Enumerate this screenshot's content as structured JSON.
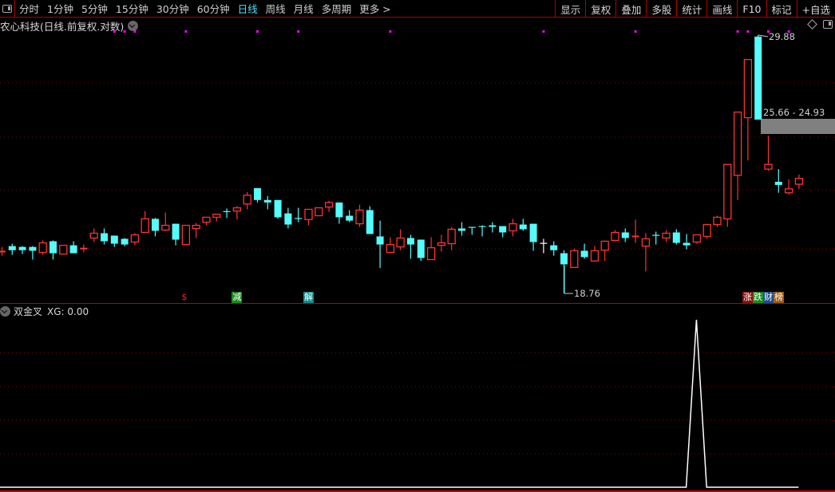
{
  "toolbar": {
    "periods": [
      "分时",
      "1分钟",
      "5分钟",
      "15分钟",
      "30分钟",
      "60分钟",
      "日线",
      "周线",
      "月线",
      "多周期",
      "更多 >"
    ],
    "active_period": "日线",
    "tools": [
      "显示",
      "复权",
      "叠加",
      "多股",
      "统计",
      "画线",
      "F10",
      "标记",
      "+自选"
    ]
  },
  "chart": {
    "title": "农心科技(日线.前复权.对数)",
    "scale": "log",
    "high_label": "29.88",
    "low_label": "18.76",
    "gap_label": "25.66 - 24.93",
    "gap_range": [
      24.93,
      25.66
    ],
    "up_color": "#ff3232",
    "down_color": "#54fcfc",
    "doji_color": "#ffffff",
    "signal_dot_color": "#ff00ff",
    "ohlc": [
      [
        20.2,
        20.4,
        20.08,
        20.26
      ],
      [
        20.43,
        20.52,
        20.11,
        20.28
      ],
      [
        20.4,
        20.43,
        20.14,
        20.28
      ],
      [
        20.4,
        20.43,
        19.94,
        20.26
      ],
      [
        20.2,
        20.64,
        20.11,
        20.55
      ],
      [
        20.61,
        20.64,
        19.94,
        20.17
      ],
      [
        20.14,
        20.46,
        20.14,
        20.46
      ],
      [
        20.46,
        20.61,
        20.17,
        20.17
      ],
      [
        20.31,
        20.49,
        20.2,
        20.37
      ],
      [
        20.73,
        21.09,
        20.58,
        20.91
      ],
      [
        20.91,
        21.09,
        20.49,
        20.61
      ],
      [
        20.82,
        20.82,
        20.4,
        20.52
      ],
      [
        20.7,
        20.73,
        20.43,
        20.49
      ],
      [
        20.58,
        20.91,
        20.46,
        20.85
      ],
      [
        20.94,
        21.76,
        20.94,
        21.46
      ],
      [
        21.46,
        21.49,
        20.79,
        21.0
      ],
      [
        21.03,
        21.7,
        21.0,
        21.21
      ],
      [
        21.27,
        21.27,
        20.46,
        20.67
      ],
      [
        20.49,
        21.21,
        20.49,
        21.21
      ],
      [
        21.09,
        21.3,
        20.73,
        21.21
      ],
      [
        21.33,
        21.52,
        21.21,
        21.52
      ],
      [
        21.52,
        21.64,
        21.36,
        21.64
      ],
      [
        21.76,
        21.86,
        21.49,
        21.73
      ],
      [
        21.76,
        21.95,
        21.43,
        21.89
      ],
      [
        22.04,
        22.52,
        21.83,
        22.39
      ],
      [
        22.68,
        22.68,
        22.1,
        22.2
      ],
      [
        22.2,
        22.36,
        21.83,
        22.1
      ],
      [
        22.2,
        22.2,
        21.46,
        21.52
      ],
      [
        21.67,
        21.89,
        21.09,
        21.24
      ],
      [
        21.49,
        21.89,
        21.33,
        21.49
      ],
      [
        21.43,
        21.83,
        21.21,
        21.83
      ],
      [
        21.58,
        21.89,
        21.58,
        21.89
      ],
      [
        21.92,
        22.17,
        21.73,
        22.1
      ],
      [
        22.1,
        22.1,
        21.27,
        21.52
      ],
      [
        21.58,
        21.8,
        21.33,
        21.39
      ],
      [
        21.27,
        22.01,
        21.15,
        21.8
      ],
      [
        21.8,
        21.95,
        20.88,
        20.88
      ],
      [
        20.79,
        21.39,
        19.64,
        20.49
      ],
      [
        20.2,
        20.76,
        20.2,
        20.49
      ],
      [
        20.4,
        21.06,
        20.28,
        20.73
      ],
      [
        20.73,
        20.85,
        19.97,
        20.49
      ],
      [
        20.67,
        20.67,
        19.89,
        20.0
      ],
      [
        19.94,
        20.76,
        19.94,
        20.37
      ],
      [
        20.46,
        20.85,
        20.23,
        20.55
      ],
      [
        20.52,
        21.15,
        20.28,
        21.06
      ],
      [
        21.09,
        21.33,
        20.82,
        21.0
      ],
      [
        21.15,
        21.15,
        20.85,
        21.12
      ],
      [
        21.18,
        21.21,
        20.79,
        21.15
      ],
      [
        21.21,
        21.33,
        20.94,
        21.15
      ],
      [
        21.18,
        21.18,
        20.76,
        20.94
      ],
      [
        21.0,
        21.46,
        20.79,
        21.27
      ],
      [
        21.24,
        21.46,
        21.0,
        21.06
      ],
      [
        21.27,
        21.27,
        20.26,
        20.58
      ],
      [
        20.55,
        20.7,
        20.17,
        20.55
      ],
      [
        20.46,
        20.61,
        20.08,
        20.28
      ],
      [
        20.17,
        20.28,
        18.76,
        19.77
      ],
      [
        19.66,
        20.34,
        19.66,
        20.26
      ],
      [
        20.26,
        20.52,
        19.97,
        20.03
      ],
      [
        19.89,
        20.43,
        19.89,
        20.26
      ],
      [
        20.28,
        20.64,
        19.89,
        20.61
      ],
      [
        20.64,
        21.03,
        20.61,
        20.94
      ],
      [
        20.94,
        21.09,
        20.58,
        20.73
      ],
      [
        20.76,
        21.43,
        20.55,
        20.82
      ],
      [
        20.43,
        20.91,
        19.52,
        20.7
      ],
      [
        20.85,
        20.97,
        20.49,
        20.82
      ],
      [
        20.73,
        21.03,
        20.58,
        20.91
      ],
      [
        20.94,
        21.06,
        20.49,
        20.55
      ],
      [
        20.55,
        20.88,
        20.31,
        20.46
      ],
      [
        20.58,
        20.85,
        20.52,
        20.85
      ],
      [
        20.79,
        21.27,
        20.7,
        21.24
      ],
      [
        21.24,
        21.58,
        21.15,
        21.52
      ],
      [
        21.46,
        23.67,
        21.15,
        23.67
      ],
      [
        23.21,
        26.01,
        22.2,
        26.01
      ],
      [
        25.75,
        28.59,
        23.84,
        28.59
      ],
      [
        29.8,
        29.88,
        25.66,
        25.66
      ],
      [
        23.47,
        24.93,
        23.4,
        23.67
      ],
      [
        22.94,
        23.47,
        22.49,
        22.81
      ],
      [
        22.49,
        23.04,
        22.42,
        22.65
      ],
      [
        22.84,
        23.24,
        22.65,
        23.08
      ]
    ],
    "signal_dots": [
      11,
      12,
      13,
      18,
      25,
      29,
      38,
      53,
      62,
      72,
      73,
      75,
      77
    ],
    "markers": [
      {
        "label": "$",
        "candle": 18,
        "color": "#ff2020",
        "bg": "transparent"
      },
      {
        "label": "减",
        "candle": 23,
        "color": "#ffffff",
        "bg": "#1a8a1a"
      },
      {
        "label": "解",
        "candle": 30,
        "color": "#ffffff",
        "bg": "#0f8a8a"
      }
    ],
    "badges": [
      {
        "label": "涨",
        "bg": "#8a1010"
      },
      {
        "label": "跌",
        "bg": "#1a8a1a"
      },
      {
        "label": "财",
        "bg": "#1a4f8a"
      },
      {
        "label": "榜",
        "bg": "#a05a10"
      }
    ]
  },
  "indicator": {
    "name": "双金叉",
    "readout": "XG: 0.00",
    "line_color": "#ffffff",
    "values_nonzero": {
      "68": 1
    },
    "ylim": [
      0,
      1
    ]
  }
}
